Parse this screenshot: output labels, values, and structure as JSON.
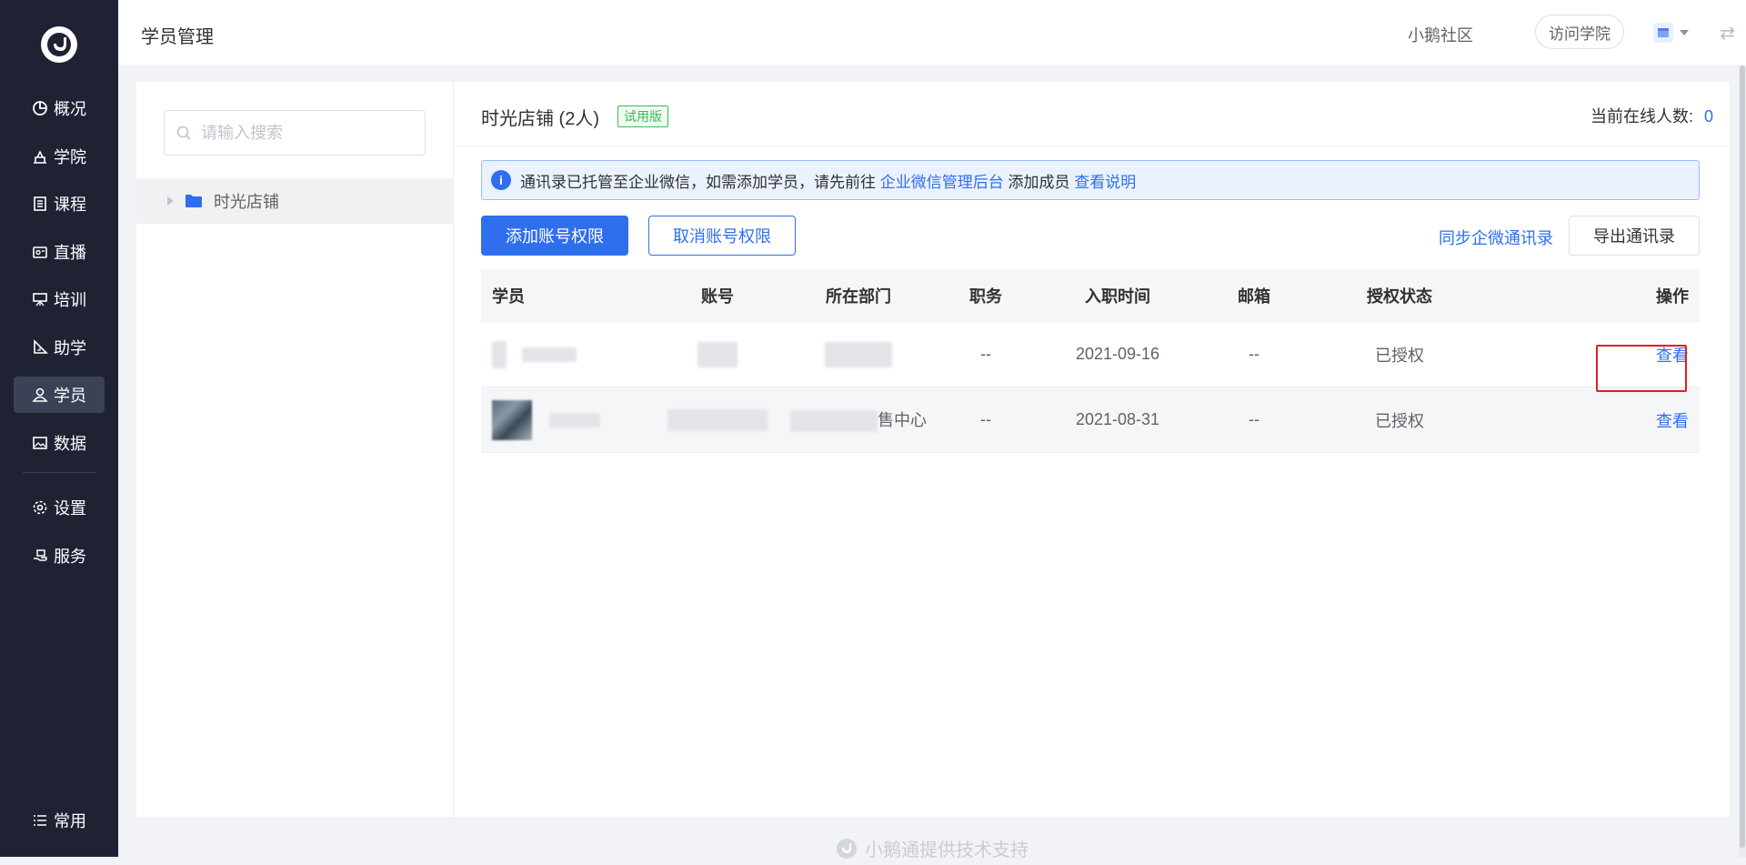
{
  "sidebar": {
    "items": [
      {
        "label": "概况",
        "icon": "pie-chart-icon"
      },
      {
        "label": "学院",
        "icon": "academy-icon"
      },
      {
        "label": "课程",
        "icon": "document-icon"
      },
      {
        "label": "直播",
        "icon": "live-icon"
      },
      {
        "label": "培训",
        "icon": "training-icon"
      },
      {
        "label": "助学",
        "icon": "ruler-icon"
      },
      {
        "label": "学员",
        "icon": "user-icon",
        "active": true
      },
      {
        "label": "数据",
        "icon": "image-chart-icon"
      },
      {
        "label": "设置",
        "icon": "gear-icon"
      },
      {
        "label": "服务",
        "icon": "service-icon"
      }
    ],
    "bottom_label": "常用"
  },
  "header": {
    "title": "学员管理",
    "community": "小鹅社区",
    "visit_button": "访问学院"
  },
  "tree": {
    "search_placeholder": "请输入搜索",
    "node_label": "时光店铺"
  },
  "main": {
    "store_title": "时光店铺 (2人)",
    "trial_tag": "试用版",
    "online_label": "当前在线人数:",
    "online_count": "0",
    "notice": {
      "text1": "通讯录已托管至企业微信，如需添加学员，请先前往",
      "link1": "企业微信管理后台",
      "text2": "添加成员",
      "link2": "查看说明"
    },
    "add_button": "添加账号权限",
    "cancel_button": "取消账号权限",
    "sync_link": "同步企微通讯录",
    "export_button": "导出通讯录"
  },
  "table": {
    "headers": [
      "学员",
      "账号",
      "所在部门",
      "职务",
      "入职时间",
      "邮箱",
      "授权状态",
      "操作"
    ],
    "rows": [
      {
        "dept_suffix": "",
        "title": "--",
        "join_date": "2021-09-16",
        "email": "--",
        "status": "已授权",
        "action": "查看"
      },
      {
        "dept_suffix": "售中心",
        "title": "--",
        "join_date": "2021-08-31",
        "email": "--",
        "status": "已授权",
        "action": "查看"
      }
    ]
  },
  "footer": {
    "text": "小鹅通提供技术支持"
  },
  "colors": {
    "accent": "#2f6fed",
    "sidebar_bg": "#1e2233",
    "highlight": "#e02020"
  }
}
